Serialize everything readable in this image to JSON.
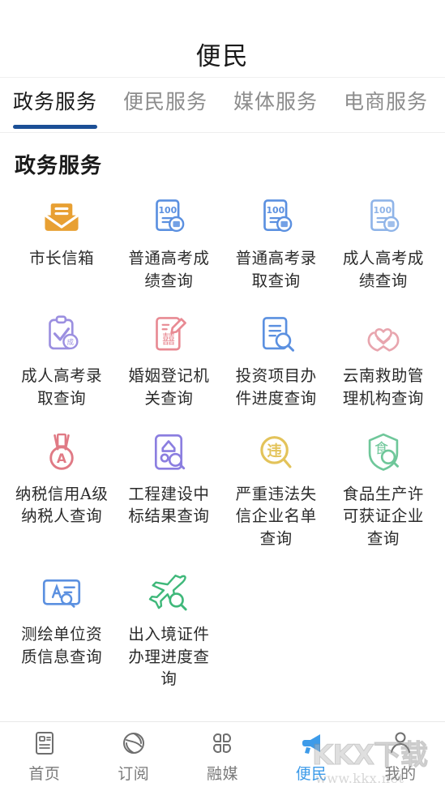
{
  "header": {
    "title": "便民"
  },
  "tabs": [
    {
      "label": "政务服务",
      "active": true
    },
    {
      "label": "便民服务",
      "active": false
    },
    {
      "label": "媒体服务",
      "active": false
    },
    {
      "label": "电商服务",
      "active": false
    }
  ],
  "section": {
    "title": "政务服务"
  },
  "services": [
    {
      "label": "市长信箱",
      "icon": "envelope-icon",
      "color": "#E8A033"
    },
    {
      "label": "普通高考成绩查询",
      "icon": "score-document-icon",
      "color": "#5B90E0"
    },
    {
      "label": "普通高考录取查询",
      "icon": "score-document-icon",
      "color": "#5B90E0"
    },
    {
      "label": "成人高考成绩查询",
      "icon": "score-document-icon",
      "color": "#8FB4E8"
    },
    {
      "label": "成人高考录取查询",
      "icon": "clipboard-check-icon",
      "color": "#9B8FE0"
    },
    {
      "label": "婚姻登记机关查询",
      "icon": "marriage-pen-icon",
      "color": "#E88A93"
    },
    {
      "label": "投资项目办件进度查询",
      "icon": "document-search-icon",
      "color": "#5B90E0"
    },
    {
      "label": "云南救助管理机构查询",
      "icon": "hands-heart-icon",
      "color": "#E8A5AE"
    },
    {
      "label": "纳税信用A级纳税人查询",
      "icon": "medal-a-icon",
      "color": "#E07A85"
    },
    {
      "label": "工程建设中标结果查询",
      "icon": "building-search-icon",
      "color": "#8B7EE0"
    },
    {
      "label": "严重违法失信企业名单查询",
      "icon": "violation-search-icon",
      "color": "#E3C35A"
    },
    {
      "label": "食品生产许可获证企业查询",
      "icon": "food-shield-icon",
      "color": "#6FC79A"
    },
    {
      "label": "测绘单位资质信息查询",
      "icon": "survey-card-icon",
      "color": "#5B90E0"
    },
    {
      "label": "出入境证件办理进度查询",
      "icon": "airplane-search-icon",
      "color": "#3FB87A"
    }
  ],
  "bottom_nav": [
    {
      "label": "首页",
      "icon": "news-page-icon",
      "active": false
    },
    {
      "label": "订阅",
      "icon": "subscribe-icon",
      "active": false
    },
    {
      "label": "融媒",
      "icon": "grid-petals-icon",
      "active": false
    },
    {
      "label": "便民",
      "icon": "megaphone-icon",
      "active": true
    },
    {
      "label": "我的",
      "icon": "person-icon",
      "active": false
    }
  ],
  "watermark": {
    "main": "KKX下载",
    "url": "www.kkx.net"
  },
  "colors": {
    "accent": "#3d9be9",
    "tab_underline": "#1b4f96",
    "text_primary": "#1a1a1a",
    "text_muted": "#8c8c8c"
  }
}
